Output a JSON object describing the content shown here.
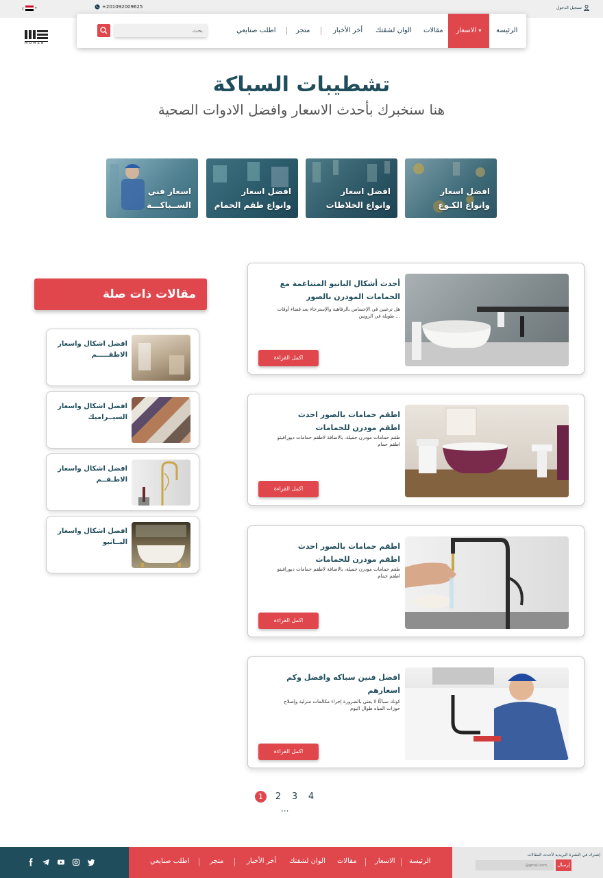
{
  "topbar": {
    "login": "تسجيل الدخول",
    "phone": "+201092009625",
    "lang": "ع"
  },
  "logo": {
    "text": "MOMEN"
  },
  "nav": {
    "items": [
      "الرئيسة",
      "الاسعار",
      "مقالات",
      "الوان لشقتك",
      "أخر الأخبار",
      "متجر",
      "اطلب صنايعي"
    ],
    "active_index": 1,
    "search_placeholder": "بحث"
  },
  "hero": {
    "title": "تشطيبات السباكة",
    "subtitle": "هنا سنخبرك بأحدث الاسعار وافضل الادوات الصحية"
  },
  "categories": [
    {
      "line1": "افضل اسعار",
      "line2": "وانواع الكـوع"
    },
    {
      "line1": "افضل اسعار",
      "line2": "وانواع الخلاطات"
    },
    {
      "line1": "افضل اسعار",
      "line2": "وانواع طقم الحمام"
    },
    {
      "line1": "اسعار فني",
      "line2": "الســباكـــة"
    }
  ],
  "related": {
    "heading": "مقالات ذات صلة",
    "items": [
      {
        "line1": "افضل اشكال واسعار",
        "line2": "الاطقـــــم"
      },
      {
        "line1": "افضل اشكال واسعار",
        "line2": "السيــراميك"
      },
      {
        "line1": "افضل اشكال واسعار",
        "line2": "الاطـقــم"
      },
      {
        "line1": "افضل اشكال واسعار",
        "line2": "البــانيو"
      }
    ]
  },
  "articles": [
    {
      "title": "أحدث أشكال البانيو المتناغمة مع الحمامات المودرن بالصور",
      "excerpt": "هل ترغبين في الإحساس بالرفاهية والإسترخاء بعد قضاء أوقات طويلة في الروتين ...",
      "button": "اكمل القراءة"
    },
    {
      "title": "اطقم حمامات بالصور احدث اطقم مودرن للحمامات",
      "excerpt": "طقم حمامات مودرن جميلة، بالاضافة لاطقم حمامات ديورافيتو اطقم حمام",
      "button": "اكمل القراءة"
    },
    {
      "title": "اطقم حمامات بالصور احدث اطقم مودرن للحمامات",
      "excerpt": "طقم حمامات مودرن جميلة، بالاضافة لاطقم حمامات ديورافيتو اطقم حمام",
      "button": "اكمل القراءة"
    },
    {
      "title": "افضل فنين سباكه وافضل وكم اسعارهم",
      "excerpt": "كونك سباكًا لا يعني بالضرورة إجراء مكالمات منزلية وإصلاح حوزات المياه طوال اليوم",
      "button": "اكمل القراءة"
    }
  ],
  "pagination": {
    "pages": [
      "1",
      "2",
      "3",
      "4"
    ],
    "active": "1",
    "more": "..."
  },
  "footer": {
    "nav": [
      "الرئيسة",
      "الاسعار",
      "مقالات",
      "الوان لشقتك",
      "أخر الأخبار",
      "متجر",
      "اطلب صنايعي"
    ],
    "newsletter_label": "إشترك في النشرة البريدية لأحدث المقالات",
    "email_placeholder": "@gmail.com",
    "send": "إرسال"
  },
  "colors": {
    "accent": "#e0474c",
    "dark": "#1f4d5c"
  }
}
